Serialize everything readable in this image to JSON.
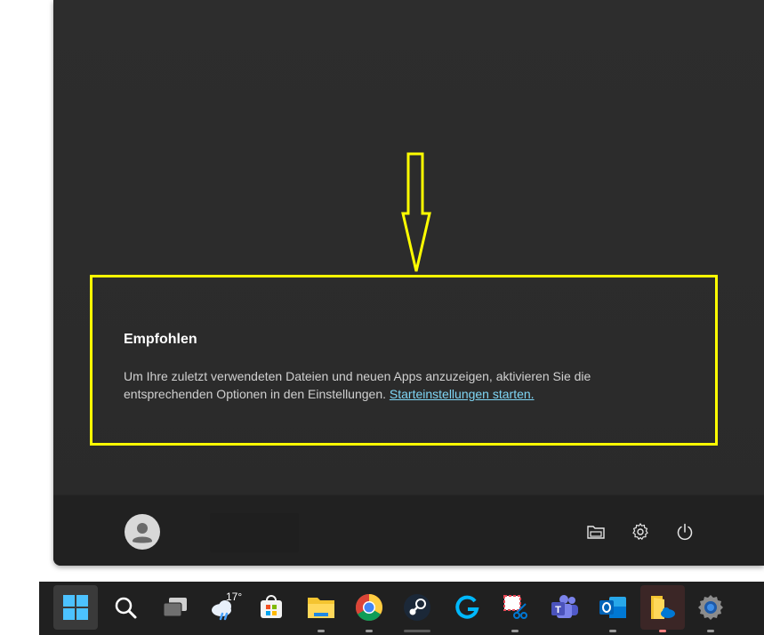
{
  "recommended": {
    "title": "Empfohlen",
    "body_line1": "Um Ihre zuletzt verwendeten Dateien und neuen Apps anzuzeigen, aktivieren Sie die",
    "body_line2": "entsprechenden Optionen in den Einstellungen. ",
    "link_text": "Starteinstellungen starten."
  },
  "footer": {
    "icons": [
      "user-avatar-icon",
      "folder-icon",
      "gear-icon",
      "power-icon"
    ]
  },
  "taskbar": {
    "weather_temp": "17°",
    "items": [
      "windows-start",
      "search",
      "task-view",
      "weather",
      "microsoft-store",
      "file-explorer",
      "chrome",
      "steam",
      "logitech",
      "snipping-tool",
      "teams",
      "outlook",
      "file-explorer-2",
      "settings"
    ]
  },
  "colors": {
    "highlight": "#ffff00",
    "link": "#7fd6f5",
    "menu_bg": "#2d2d2d",
    "taskbar_bg": "#202020"
  }
}
